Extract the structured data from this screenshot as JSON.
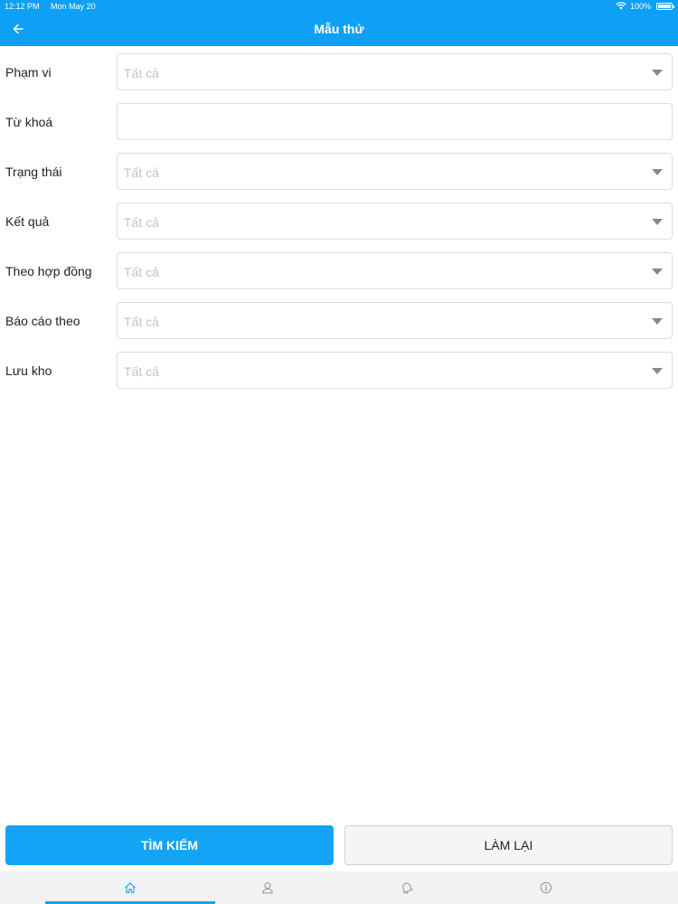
{
  "status_bar": {
    "time": "12:12 PM",
    "date": "Mon May 20",
    "battery": "100%"
  },
  "header": {
    "title": "Mẫu thử",
    "back_icon": "arrow-left-icon"
  },
  "form": {
    "fields": [
      {
        "label": "Phạm vi",
        "type": "select",
        "placeholder": "Tất cả"
      },
      {
        "label": "Từ khoá",
        "type": "text",
        "placeholder": ""
      },
      {
        "label": "Trạng thái",
        "type": "select",
        "placeholder": "Tất cả"
      },
      {
        "label": "Kết quả",
        "type": "select",
        "placeholder": "Tất cả"
      },
      {
        "label": "Theo hợp đồng",
        "type": "select",
        "placeholder": "Tất cả"
      },
      {
        "label": "Báo cáo theo",
        "type": "select",
        "placeholder": "Tất cả"
      },
      {
        "label": "Lưu kho",
        "type": "select",
        "placeholder": "Tất cả"
      }
    ]
  },
  "actions": {
    "search_label": "TÌM KIẾM",
    "reset_label": "LÀM LẠI"
  },
  "tab_bar": {
    "tabs": [
      {
        "icon": "home-icon",
        "active": true
      },
      {
        "icon": "user-icon",
        "active": false
      },
      {
        "icon": "bell-icon",
        "active": false
      },
      {
        "icon": "info-icon",
        "active": false
      }
    ]
  },
  "colors": {
    "primary": "#0da0f5",
    "placeholder": "#c3c3c3",
    "border": "#dcdcdc"
  }
}
